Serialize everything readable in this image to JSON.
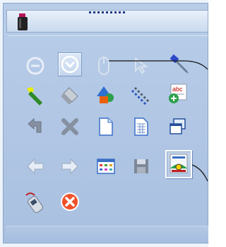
{
  "panel": {
    "title_icon": "bottle-icon",
    "grip_label": "........",
    "colors": {
      "panel": "#adc3e2",
      "title": "#dbe6f4",
      "border": "#8aa4c8"
    }
  },
  "toolbar": {
    "rows": [
      [
        "minus-circle-icon",
        "dropdown-circle-icon",
        "mouse-icon",
        "cursor-arrow-icon",
        "blue-pencil-icon"
      ],
      [
        "green-marker-icon",
        "eraser-icon",
        "shapes-icon",
        "diagonal-dashes-icon",
        "spellcheck-add-icon"
      ],
      [
        "undo-arrow-icon",
        "close-x-icon",
        "document-icon",
        "spreadsheet-icon",
        "window-copy-icon"
      ],
      [
        "back-arrow-icon",
        "forward-arrow-icon",
        "calendar-grid-icon",
        "save-disk-icon",
        "web-glasses-icon"
      ],
      [
        "phone-icon",
        "red-cancel-icon"
      ]
    ],
    "selected": "dropdown-circle-icon",
    "pressed": "web-glasses-icon",
    "spellcheck_text": "abc"
  }
}
